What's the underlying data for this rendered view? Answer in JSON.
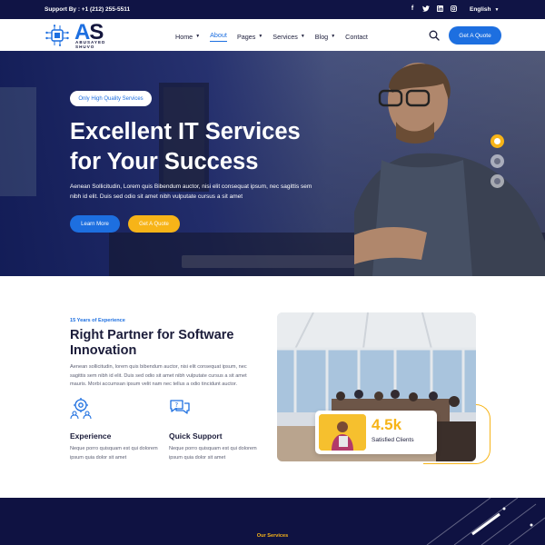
{
  "topbar": {
    "support": "Support By : +1 (212) 255-5511",
    "social_icons": [
      "facebook-icon",
      "twitter-icon",
      "linkedin-icon",
      "instagram-icon"
    ],
    "language": "English"
  },
  "navbar": {
    "logo_mark": "AS",
    "logo_name": "ABUSAYED SHUVO",
    "menu": [
      {
        "label": "Home",
        "dropdown": true
      },
      {
        "label": "About",
        "dropdown": false,
        "active": true
      },
      {
        "label": "Pages",
        "dropdown": true
      },
      {
        "label": "Services",
        "dropdown": true
      },
      {
        "label": "Blog",
        "dropdown": true
      },
      {
        "label": "Contact",
        "dropdown": false
      }
    ],
    "quote_button": "Get A Quote"
  },
  "hero": {
    "badge": "Only High Quality Services",
    "title_line1": "Excellent IT Services",
    "title_line2": "for Your Success",
    "description": "Aenean Sollicitudin, Lorem quis Bibendum auctor, nisi elit consequat ipsum, nec sagittis sem nibh id elit. Duis sed odio sit amet nibh vulputate cursus a sit amet",
    "learn_button": "Learn More",
    "quote_button": "Get A Quote",
    "slider_active_index": 0,
    "slider_count": 3
  },
  "about": {
    "eyebrow": "15 Years of Experience",
    "title": "Right Partner for Software Innovation",
    "paragraph": "Aenean sollicitudin, lorem quis bibendum auctor, nisi elit consequat ipsum, nec sagittis sem nibh id elit. Duis sed odio sit amet nibh vulputate cursus a sit amet mauris. Morbi accumsan ipsum velit nam nec tellus a odio tincidunt auctor.",
    "features": [
      {
        "icon": "gear-people-icon",
        "title": "Experience",
        "text": "Neque porro quisquam est qui dolorem ipsum quia dolor sit amet"
      },
      {
        "icon": "chat-bubbles-icon",
        "title": "Quick Support",
        "text": "Neque porro quisquam est qui dolorem ipsum quia dolor sit amet"
      }
    ],
    "stat_value": "4.5k",
    "stat_label": "Satisfied Clients"
  },
  "services": {
    "label": "Our Services"
  },
  "colors": {
    "primary": "#1d6fe0",
    "accent": "#f7b418",
    "dark": "#101445"
  }
}
